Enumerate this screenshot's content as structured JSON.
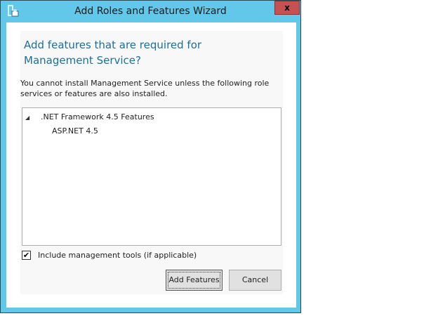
{
  "window": {
    "title": "Add Roles and Features Wizard",
    "close_label": "x"
  },
  "dialog": {
    "heading": "Add features that are required for Management Service?",
    "message": "You cannot install Management Service unless the following role services or features are also installed.",
    "tree": [
      {
        "label": ".NET Framework 4.5 Features",
        "expanded": true,
        "children": [
          {
            "label": "ASP.NET 4.5"
          }
        ]
      }
    ],
    "include_tools": {
      "label": "Include management tools (if applicable)",
      "checked": true
    },
    "buttons": {
      "add": "Add Features",
      "cancel": "Cancel"
    }
  }
}
